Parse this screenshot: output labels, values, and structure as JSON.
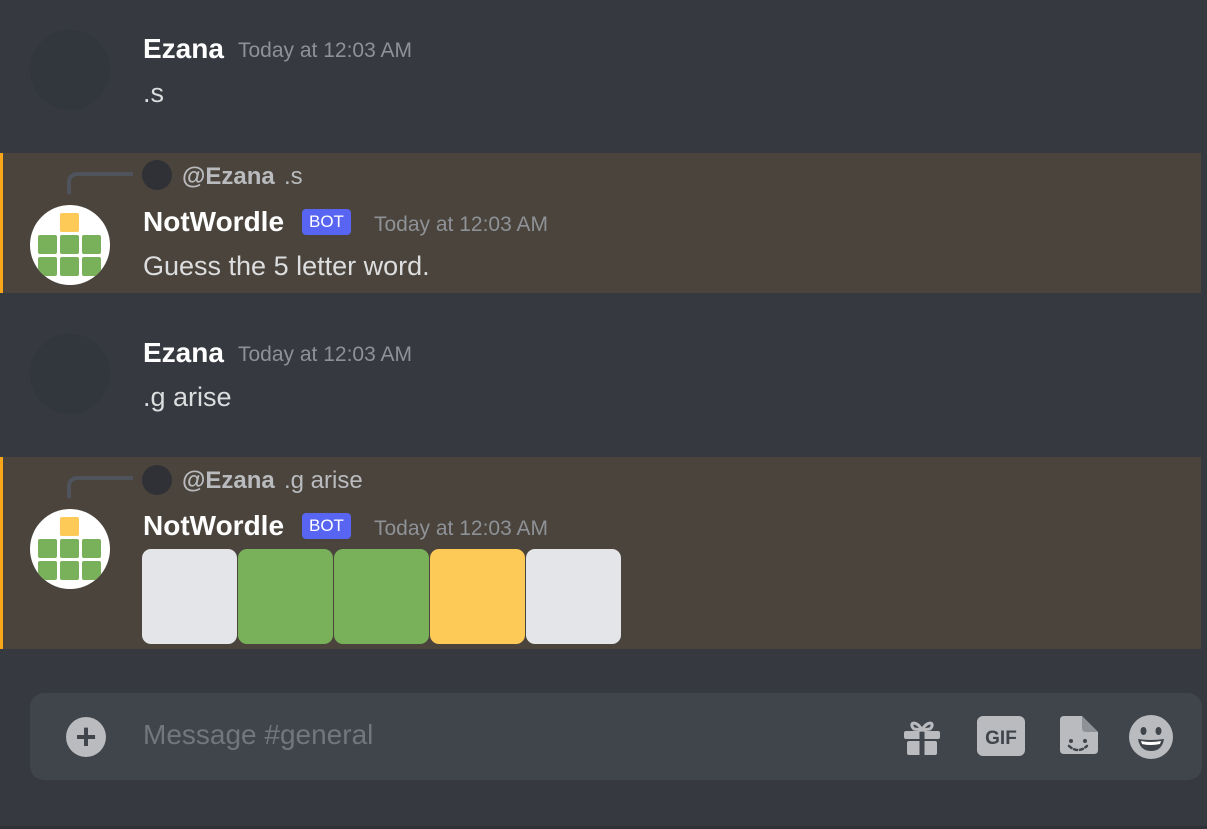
{
  "messages": [
    {
      "username": "Ezana",
      "timestamp": "Today at 12:03 AM",
      "content": ".s"
    },
    {
      "reply": {
        "user": "@Ezana",
        "text": ".s"
      },
      "username": "NotWordle",
      "bot_tag": "BOT",
      "timestamp": "Today at 12:03 AM",
      "content": "Guess the 5 letter word."
    },
    {
      "username": "Ezana",
      "timestamp": "Today at 12:03 AM",
      "content": ".g arise"
    },
    {
      "reply": {
        "user": "@Ezana",
        "text": ".g arise"
      },
      "username": "NotWordle",
      "bot_tag": "BOT",
      "timestamp": "Today at 12:03 AM",
      "tiles": [
        "gray",
        "green",
        "green",
        "yellow",
        "gray"
      ]
    }
  ],
  "composer": {
    "placeholder": "Message #general",
    "gif_label": "GIF",
    "icons": [
      "plus-icon",
      "gift-icon",
      "gif-icon",
      "sticker-icon",
      "emoji-icon"
    ]
  },
  "colors": {
    "green": "#79b15a",
    "yellow": "#fdc957",
    "gray": "#e3e5e8",
    "mention_bg": "#4a443c",
    "mention_bar": "#faa61a",
    "bot_tag": "#5865f2"
  }
}
